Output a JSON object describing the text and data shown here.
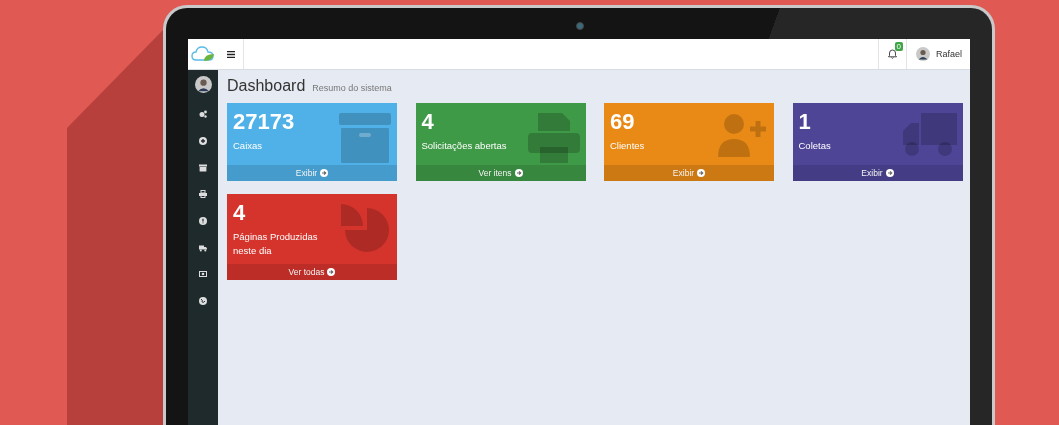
{
  "header": {
    "notification_count": "0",
    "user_name": "Rafael"
  },
  "page": {
    "title": "Dashboard",
    "subtitle": "Resumo do sistema"
  },
  "cards": [
    {
      "value": "27173",
      "label": "Caixas",
      "link": "Exibir",
      "color": "#4fb1e8",
      "kind": "box"
    },
    {
      "value": "4",
      "label": "Solicitações abertas",
      "link": "Ver itens",
      "color": "#3f9a47",
      "kind": "printer"
    },
    {
      "value": "69",
      "label": "Clientes",
      "link": "Exibir",
      "color": "#e98a16",
      "kind": "user-add"
    },
    {
      "value": "1",
      "label": "Coletas",
      "link": "Exibir",
      "color": "#4e4597",
      "kind": "truck"
    },
    {
      "value": "4",
      "label": "Páginas Produzidas neste dia",
      "link": "Ver todas",
      "color": "#d5342c",
      "kind": "pie"
    }
  ]
}
